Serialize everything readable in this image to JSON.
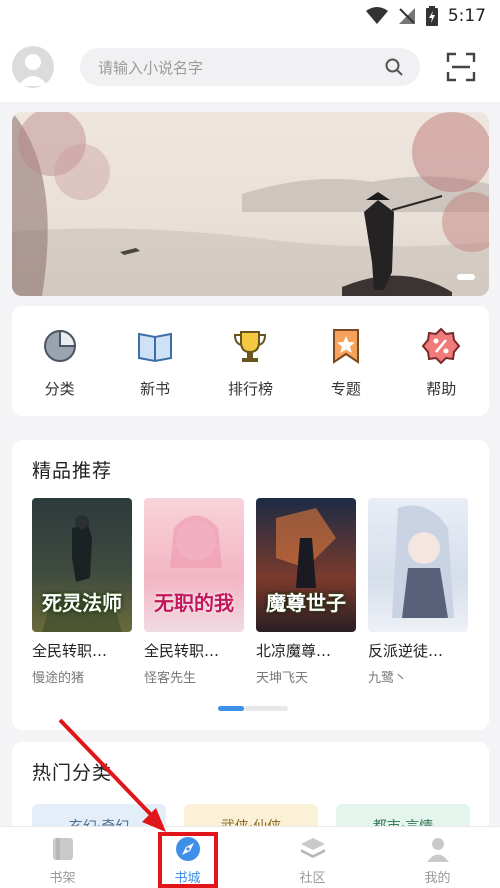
{
  "status_bar": {
    "time": "5:17"
  },
  "search": {
    "placeholder": "请输入小说名字"
  },
  "quick_nav": [
    {
      "label": "分类",
      "icon": "category-pie-icon"
    },
    {
      "label": "新书",
      "icon": "book-open-icon"
    },
    {
      "label": "排行榜",
      "icon": "trophy-icon"
    },
    {
      "label": "专题",
      "icon": "bookmark-star-icon"
    },
    {
      "label": "帮助",
      "icon": "help-badge-icon"
    }
  ],
  "recommend": {
    "title": "精品推荐",
    "books": [
      {
        "title": "全民转职…",
        "author": "慢途的猪",
        "cover_text": "死灵法师"
      },
      {
        "title": "全民转职…",
        "author": "怪客先生",
        "cover_text": "无职的我"
      },
      {
        "title": "北凉魔尊…",
        "author": "天坤飞天",
        "cover_text": "魔尊世子"
      },
      {
        "title": "反派逆徒…",
        "author": "九鹭丶",
        "cover_text": ""
      }
    ]
  },
  "hot_categories": {
    "title": "热门分类",
    "items": [
      {
        "label": "玄幻·奇幻",
        "color": "#e3eef8"
      },
      {
        "label": "武侠·仙侠",
        "color": "#fbf1d6"
      },
      {
        "label": "都市·言情",
        "color": "#e3f5ec"
      }
    ]
  },
  "tabs": [
    {
      "label": "书架",
      "icon": "bookshelf-icon",
      "active": false
    },
    {
      "label": "书城",
      "icon": "compass-icon",
      "active": true
    },
    {
      "label": "社区",
      "icon": "layers-icon",
      "active": false
    },
    {
      "label": "我的",
      "icon": "user-icon",
      "active": false
    }
  ],
  "colors": {
    "accent": "#3d8fe8",
    "annotation": "#e0161b"
  }
}
